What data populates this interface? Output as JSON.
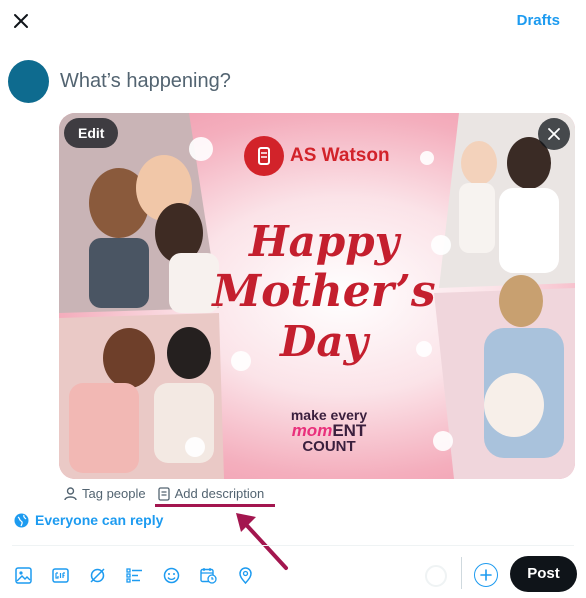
{
  "header": {
    "drafts_label": "Drafts"
  },
  "composer": {
    "placeholder": "What’s happening?"
  },
  "media": {
    "edit_label": "Edit",
    "brand_name": "AS Watson",
    "headline": [
      "Happy",
      "Mother’s",
      "Day"
    ],
    "tagline": {
      "line1": "make every",
      "highlight": "mom",
      "rest": "ENT",
      "line3": "COUNT"
    }
  },
  "media_actions": {
    "tag_people": "Tag people",
    "add_description": "Add description"
  },
  "reply_setting": {
    "label": "Everyone can reply"
  },
  "toolbar": {
    "icons": [
      "image-icon",
      "gif-icon",
      "grok-icon",
      "poll-icon",
      "emoji-icon",
      "schedule-icon",
      "location-icon"
    ]
  },
  "post_label": "Post",
  "colors": {
    "accent": "#1d9bf0",
    "post_button": "#0f1419",
    "highlight_underline": "#a3164f",
    "brand_red": "#d2232a"
  }
}
